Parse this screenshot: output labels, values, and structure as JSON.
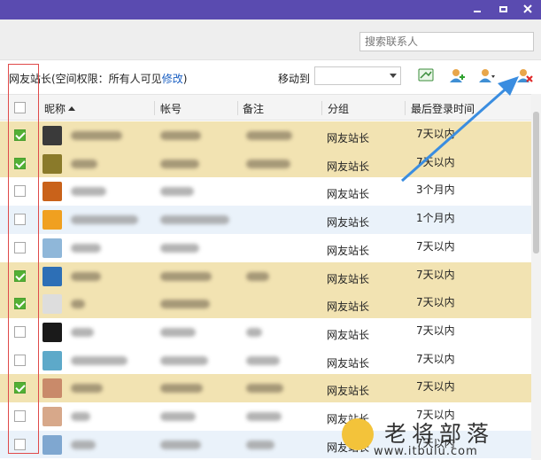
{
  "search": {
    "placeholder": "搜索联系人"
  },
  "toolbar": {
    "group_title": "网友站长(空间权限：所有人可见",
    "edit_link": "修改",
    "group_title_suffix": ")",
    "move_to_label": "移动到",
    "move_to_value": ""
  },
  "table": {
    "columns": {
      "nickname": "昵称",
      "account": "帐号",
      "remark": "备注",
      "group": "分组",
      "last_login": "最后登录时间"
    },
    "rows": [
      {
        "checked": true,
        "group": "网友站长",
        "last_login": "7天以内",
        "avatar": "#3a3a3a"
      },
      {
        "checked": true,
        "group": "网友站长",
        "last_login": "7天以内",
        "avatar": "#8a7a2a"
      },
      {
        "checked": false,
        "group": "网友站长",
        "last_login": "3个月内",
        "avatar": "#c9621a"
      },
      {
        "checked": false,
        "group": "网友站长",
        "last_login": "1个月内",
        "avatar": "#f0a020"
      },
      {
        "checked": false,
        "group": "网友站长",
        "last_login": "7天以内",
        "avatar": "#8fb7d9"
      },
      {
        "checked": true,
        "group": "网友站长",
        "last_login": "7天以内",
        "avatar": "#2d6fb6"
      },
      {
        "checked": true,
        "group": "网友站长",
        "last_login": "7天以内",
        "avatar": "#dddddd"
      },
      {
        "checked": false,
        "group": "网友站长",
        "last_login": "7天以内",
        "avatar": "#1a1a1a"
      },
      {
        "checked": false,
        "group": "网友站长",
        "last_login": "7天以内",
        "avatar": "#5da9c9"
      },
      {
        "checked": true,
        "group": "网友站长",
        "last_login": "7天以内",
        "avatar": "#c98a6a"
      },
      {
        "checked": false,
        "group": "网友站长",
        "last_login": "7天以内",
        "avatar": "#d7a88a"
      },
      {
        "checked": false,
        "group": "网友站长",
        "last_login": "7天以内",
        "avatar": "#7fa7d0"
      }
    ]
  },
  "watermark": {
    "text": "老将部落",
    "url": "www.itbulu.com"
  },
  "colors": {
    "titlebar": "#5a4bb0",
    "selected_row": "#f2e3b2",
    "check_green": "#52b035",
    "annotation_red": "#e04a4a",
    "arrow_blue": "#3a8de0",
    "link": "#1a5fc2"
  },
  "icons": [
    "minimize-icon",
    "maximize-icon",
    "close-icon",
    "message-icon",
    "add-contact-icon",
    "contacts-menu-icon",
    "delete-contact-icon",
    "sort-ascending-icon"
  ]
}
